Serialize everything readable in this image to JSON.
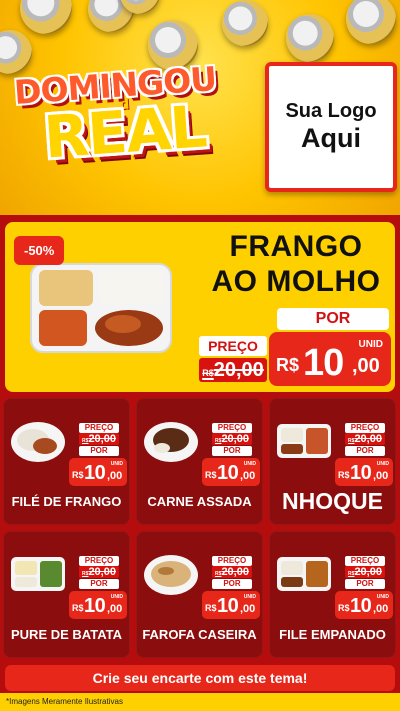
{
  "header": {
    "title_line1": "DOMINGOU",
    "title_small": "d",
    "title_line2": "REAL",
    "logo_line1": "Sua Logo",
    "logo_line2": "Aqui"
  },
  "hero": {
    "discount": "-50%",
    "name_line1": "FRANGO",
    "name_line2": "AO MOLHO",
    "por_label": "POR",
    "preco_label": "PREÇO",
    "old_currency": "R$",
    "old_price": "20,00",
    "unid_label": "UNID",
    "currency": "R$",
    "price_int": "10",
    "price_cents": ",00"
  },
  "products": [
    {
      "name": "FILÉ DE FRANGO",
      "preco_label": "PREÇO",
      "old_currency": "R$",
      "old_price": "20,00",
      "por_label": "POR",
      "unid_label": "UNID",
      "currency": "R$",
      "price_int": "10",
      "price_cents": ",00"
    },
    {
      "name": "CARNE ASSADA",
      "preco_label": "PREÇO",
      "old_currency": "R$",
      "old_price": "20,00",
      "por_label": "POR",
      "unid_label": "UNID",
      "currency": "R$",
      "price_int": "10",
      "price_cents": ",00"
    },
    {
      "name": "NHOQUE",
      "preco_label": "PREÇO",
      "old_currency": "R$",
      "old_price": "20,00",
      "por_label": "POR",
      "unid_label": "UNID",
      "currency": "R$",
      "price_int": "10",
      "price_cents": ",00"
    },
    {
      "name": "PURE DE BATATA",
      "preco_label": "PREÇO",
      "old_currency": "R$",
      "old_price": "20,00",
      "por_label": "POR",
      "unid_label": "UNID",
      "currency": "R$",
      "price_int": "10",
      "price_cents": ",00"
    },
    {
      "name": "FAROFA CASEIRA",
      "preco_label": "PREÇO",
      "old_currency": "R$",
      "old_price": "20,00",
      "por_label": "POR",
      "unid_label": "UNID",
      "currency": "R$",
      "price_int": "10",
      "price_cents": ",00"
    },
    {
      "name": "FILE EMPANADO",
      "preco_label": "PREÇO",
      "old_currency": "R$",
      "old_price": "20,00",
      "por_label": "POR",
      "unid_label": "UNID",
      "currency": "R$",
      "price_int": "10",
      "price_cents": ",00"
    }
  ],
  "footer": {
    "cta": "Crie seu encarte com este tema!",
    "disclaimer": "*Imagens Meramente Ilustrativas"
  },
  "colors": {
    "yellow": "#ffd000",
    "red": "#e8271b",
    "dark_red": "#8c0d0d",
    "background": "#b50d0d"
  }
}
